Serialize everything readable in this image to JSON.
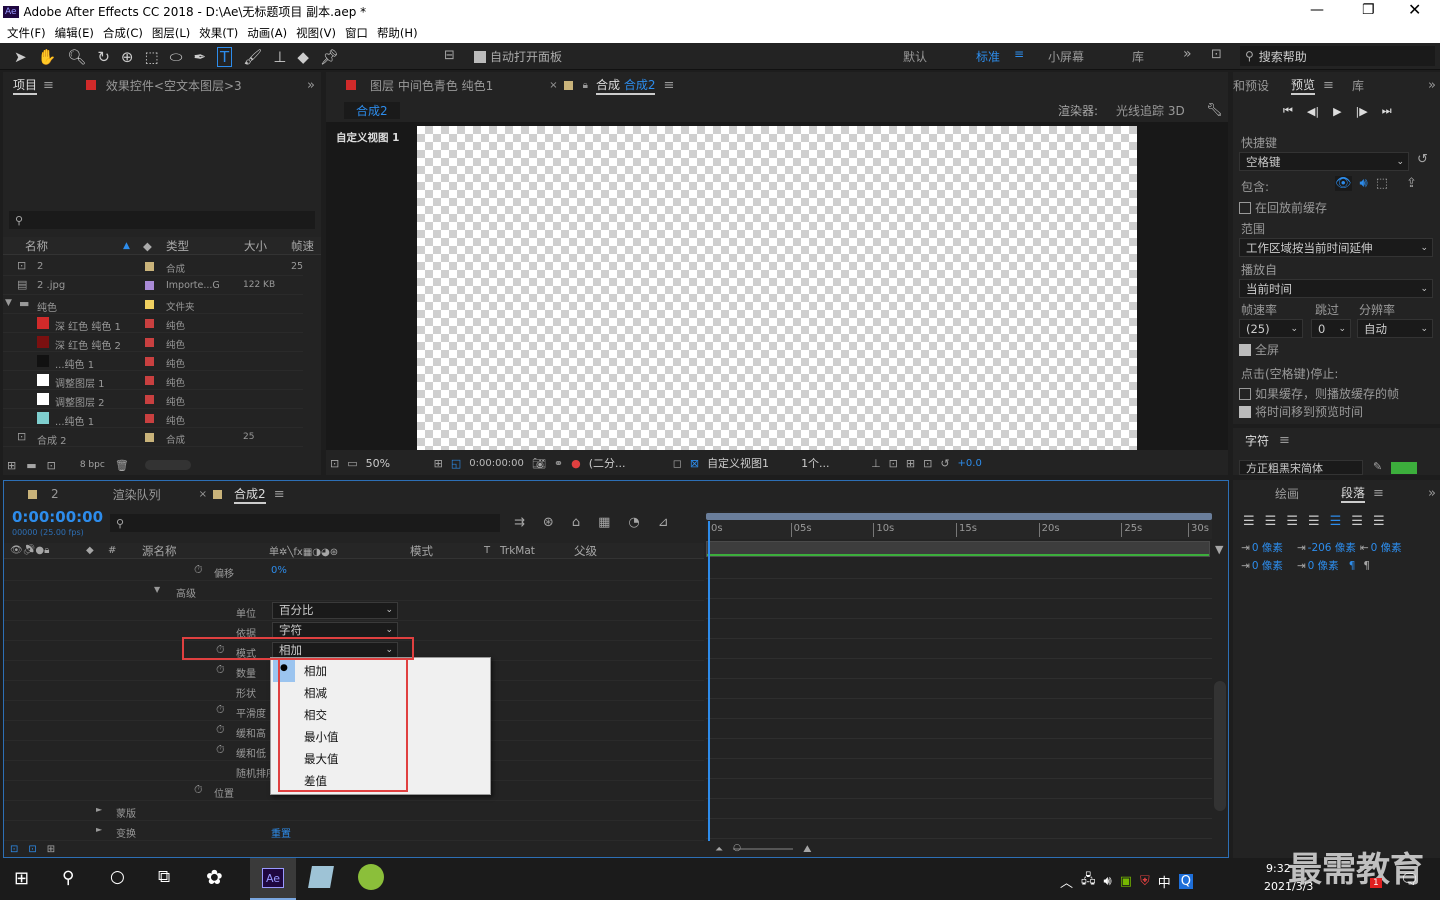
{
  "window": {
    "app_icon": "Ae",
    "title": "Adobe After Effects CC 2018 - D:\\Ae\\无标题项目 副本.aep *"
  },
  "menu": [
    "文件(F)",
    "编辑(E)",
    "合成(C)",
    "图层(L)",
    "效果(T)",
    "动画(A)",
    "视图(V)",
    "窗口",
    "帮助(H)"
  ],
  "toolbar": {
    "auto_open": "自动打开面板",
    "workspaces": [
      "默认",
      "标准",
      "小屏幕",
      "库"
    ],
    "search": "搜索帮助"
  },
  "project": {
    "tab": "项目",
    "effects_tab": "效果控件<空文本图层>3",
    "columns": [
      "名称",
      "类型",
      "大小",
      "帧速"
    ],
    "rows": [
      {
        "name": "2",
        "type": "合成",
        "size": "",
        "fps": "25",
        "color": "#c9b37a",
        "indent": 0
      },
      {
        "name": "2 .jpg",
        "type": "Importe...G",
        "size": "122 KB",
        "fps": "",
        "color": "#a98ad6",
        "indent": 0
      },
      {
        "name": "纯色",
        "type": "文件夹",
        "size": "",
        "fps": "",
        "color": "#f0d060",
        "indent": 0
      },
      {
        "name": "深 红色 纯色 1",
        "type": "纯色",
        "size": "",
        "fps": "",
        "color": "#c94040",
        "indent": 1,
        "sw": "#d02a2a"
      },
      {
        "name": "深 红色 纯色 2",
        "type": "纯色",
        "size": "",
        "fps": "",
        "color": "#c94040",
        "indent": 1,
        "sw": "#7a1010"
      },
      {
        "name": "...纯色 1",
        "type": "纯色",
        "size": "",
        "fps": "",
        "color": "#c94040",
        "indent": 1,
        "sw": "#111111"
      },
      {
        "name": "调整图层 1",
        "type": "纯色",
        "size": "",
        "fps": "",
        "color": "#c94040",
        "indent": 1,
        "sw": "#ffffff"
      },
      {
        "name": "调整图层 2",
        "type": "纯色",
        "size": "",
        "fps": "",
        "color": "#c94040",
        "indent": 1,
        "sw": "#ffffff"
      },
      {
        "name": "...纯色 1",
        "type": "纯色",
        "size": "",
        "fps": "",
        "color": "#c94040",
        "indent": 1,
        "sw": "#7fcfcf"
      },
      {
        "name": "合成 2",
        "type": "合成",
        "size": "25",
        "fps": "",
        "color": "#c9b37a",
        "indent": 0
      }
    ],
    "bpc": "8 bpc"
  },
  "viewer": {
    "layer_tab": "图层 中间色青色 纯色1",
    "comp_tab_prefix": "合成",
    "comp_tab_name": "合成2",
    "breadcrumb": "合成2",
    "renderer_label": "渲染器:",
    "renderer": "光线追踪 3D",
    "view_label": "自定义视图 1",
    "bottom": {
      "zoom": "50%",
      "time": "0:00:00:00",
      "quality": "(二分...",
      "view": "自定义视图1",
      "views": "1个...",
      "exposure": "+0.0"
    }
  },
  "right": {
    "tabs": [
      "和预设",
      "预览",
      "库"
    ],
    "shortcut_label": "快捷键",
    "shortcut": "空格键",
    "include_label": "包含:",
    "cache_before": "在回放前缓存",
    "range_label": "范围",
    "range": "工作区域按当前时间延伸",
    "play_from_label": "播放自",
    "play_from": "当前时间",
    "fps_label": "帧速率",
    "skip_label": "跳过",
    "res_label": "分辨率",
    "fps": "(25)",
    "skip": "0",
    "res": "自动",
    "fullscreen": "全屏",
    "stop_label": "点击(空格键)停止:",
    "if_cached": "如果缓存，则播放缓存的帧",
    "move_time": "将时间移到预览时间",
    "char_tab": "字符",
    "font": "方正粗黑宋简体",
    "para_tabs": [
      "绘画",
      "段落"
    ],
    "indent_vals": [
      "0 像素",
      "-206 像素",
      "0 像素",
      "0 像素",
      "0 像素"
    ]
  },
  "timeline": {
    "tabs": [
      "2",
      "渲染队列",
      "合成2"
    ],
    "timecode": "0:00:00:00",
    "fps_note": "00000 (25.00 fps)",
    "col_source": "源名称",
    "col_mode": "模式",
    "col_t": "T",
    "col_trkmat": "TrkMat",
    "col_parent": "父级",
    "ruler": [
      "0s",
      "05s",
      "10s",
      "15s",
      "20s",
      "25s",
      "30s"
    ],
    "rows": [
      {
        "label": "偏移",
        "value": "0%",
        "indent": 1,
        "stopwatch": true
      },
      {
        "label": "高级",
        "value": "",
        "indent": 0,
        "arrow": "▼"
      },
      {
        "label": "单位",
        "value": "",
        "indent": 2,
        "dd": "百分比"
      },
      {
        "label": "依据",
        "value": "",
        "indent": 2,
        "dd": "字符"
      },
      {
        "label": "模式",
        "value": "",
        "indent": 2,
        "dd": "相加",
        "stopwatch": true
      },
      {
        "label": "数量",
        "value": "",
        "indent": 2,
        "stopwatch": true
      },
      {
        "label": "形状",
        "value": "",
        "indent": 2
      },
      {
        "label": "平滑度",
        "value": "",
        "indent": 2,
        "stopwatch": true
      },
      {
        "label": "缓和高",
        "value": "",
        "indent": 2,
        "stopwatch": true
      },
      {
        "label": "缓和低",
        "value": "",
        "indent": 2,
        "stopwatch": true
      },
      {
        "label": "随机排序",
        "value": "",
        "indent": 2
      },
      {
        "label": "位置",
        "value": "",
        "indent": 1,
        "stopwatch": true
      },
      {
        "label": "蒙版",
        "value": "",
        "indent": 0,
        "arrow": "►"
      },
      {
        "label": "变换",
        "value": "重置",
        "indent": 0,
        "arrow": "►"
      }
    ],
    "dropdown": [
      "相加",
      "相减",
      "相交",
      "最小值",
      "最大值",
      "差值"
    ],
    "selected": "相加"
  },
  "taskbar": {
    "time": "9:32",
    "date": "2021/3/3",
    "ime": "中",
    "badge": "1",
    "watermark": "最需教育"
  }
}
